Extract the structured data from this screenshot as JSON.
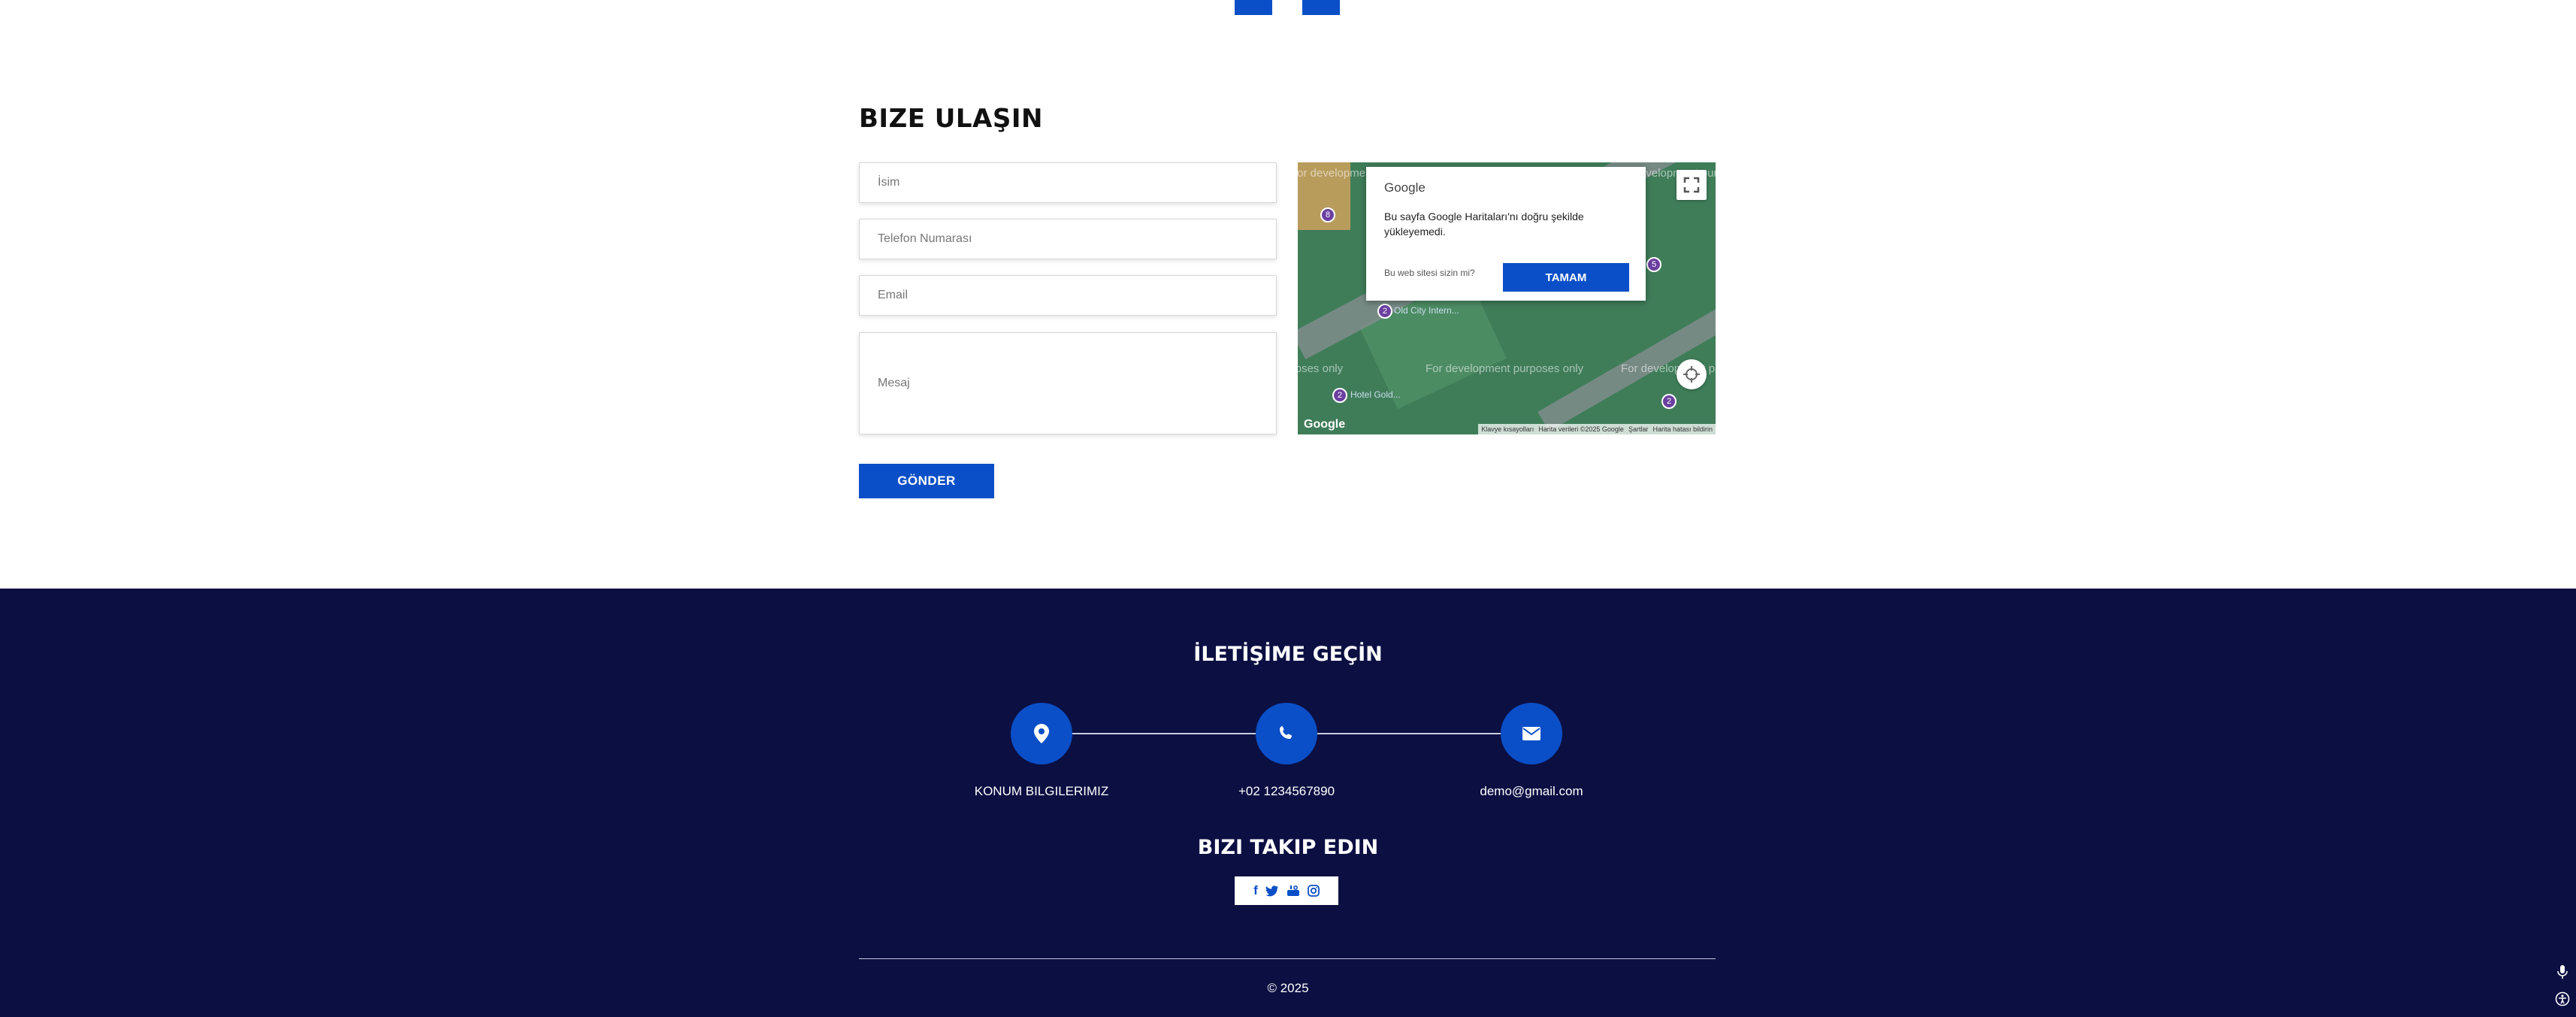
{
  "contact": {
    "title": "BIZE ULAŞIN",
    "fields": {
      "name": "İsim",
      "phone": "Telefon Numarası",
      "email": "Email",
      "message": "Mesaj"
    },
    "submit_label": "GÖNDER"
  },
  "map": {
    "dialog_logo": "Google",
    "dialog_message": "Bu sayfa Google Haritaları'nı doğru şekilde yükleyemedi.",
    "dialog_owner_link": "Bu web sitesi sizin mi?",
    "dialog_ok_label": "TAMAM",
    "watermark": "For development purposes only",
    "place_labels": [
      "Old City Intern...",
      "Hotel Gold..."
    ],
    "google_logo": "Google",
    "footer_links": [
      "Klavye kısayolları",
      "Harita verileri ©2025 Google",
      "Şartlar",
      "Harita hatası bildirin"
    ],
    "fullscreen_icon": "fullscreen-icon",
    "locate_icon": "crosshair-icon"
  },
  "footer": {
    "get_in_touch_title": "İLETİŞİME GEÇİN",
    "items": [
      {
        "icon": "location-pin-icon",
        "label": "KONUM BILGILERIMIZ"
      },
      {
        "icon": "phone-icon",
        "label": "+02 1234567890"
      },
      {
        "icon": "envelope-icon",
        "label": "demo@gmail.com"
      }
    ],
    "follow_title": "BIZI TAKIP EDIN",
    "social_icons": [
      "facebook-icon",
      "twitter-icon",
      "youtube-icon",
      "instagram-icon"
    ],
    "copyright": "© 2025"
  },
  "colors": {
    "accent": "#0a4fc7",
    "footer_bg": "#0b0f42"
  }
}
